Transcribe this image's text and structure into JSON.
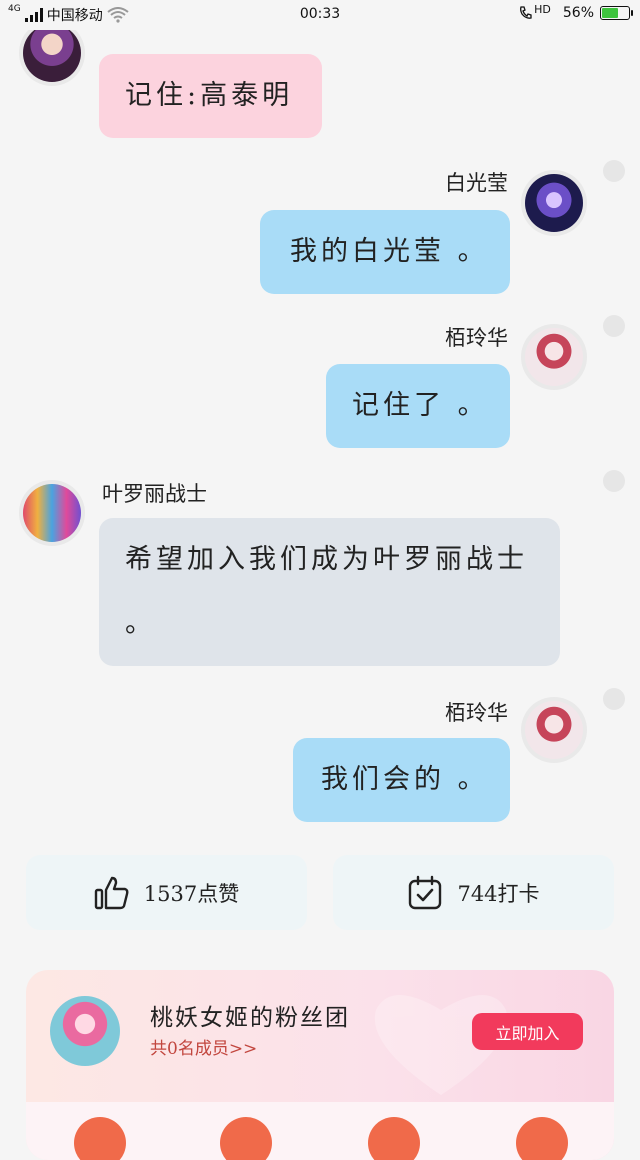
{
  "status_bar": {
    "network": "4G",
    "carrier": "中国移动",
    "time": "00:33",
    "hd": "HD",
    "battery_percent": "56%",
    "battery_level": 0.56
  },
  "messages": [
    {
      "sender": "",
      "text": "记住:高泰明",
      "side": "left"
    },
    {
      "sender": "白光莹",
      "text": "我的白光莹 。",
      "side": "right"
    },
    {
      "sender": "栢玲华",
      "text": "记住了 。",
      "side": "right"
    },
    {
      "sender": "叶罗丽战士",
      "text": "希望加入我们成为叶罗丽战士 。",
      "side": "left"
    },
    {
      "sender": "栢玲华",
      "text": "我们会的 。",
      "side": "right"
    }
  ],
  "stats": {
    "likes_label": "1537点赞",
    "checkin_label": "744打卡"
  },
  "fan_club": {
    "title": "桃妖女姬的粉丝团",
    "subtitle": "共0名成员>>",
    "join_label": "立即加入"
  },
  "colors": {
    "pink_bubble": "#fcd3de",
    "blue_bubble": "#a9dcf7",
    "gray_bubble": "#dfe4ea",
    "join_button": "#f23a5c"
  },
  "icons": {
    "like": "thumbs-up-icon",
    "checkin": "calendar-check-icon"
  }
}
